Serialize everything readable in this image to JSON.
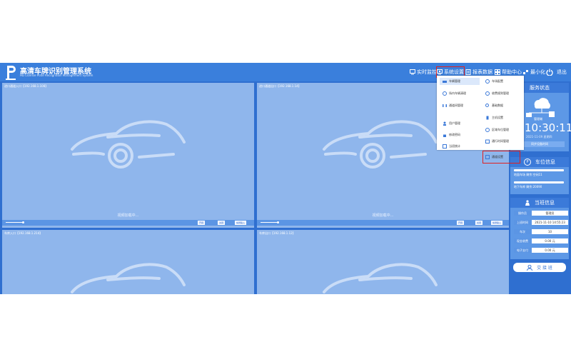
{
  "app": {
    "title": "高清车牌识别管理系统",
    "subtitle": "HD License Plate Recognition Management System"
  },
  "nav": {
    "monitor": "实时监控",
    "settings": "系统设置",
    "reports": "报表数据",
    "help": "帮助中心",
    "minimize": "最小化",
    "exit": "退出"
  },
  "menu": {
    "left": [
      "车辆管理",
      "场内车辆清理",
      "通道间管理",
      "用户管理",
      "修改密码",
      "当班统计"
    ],
    "right": [
      "车场配置",
      "收费规则管理",
      "基础数据",
      "主机设置",
      "区域车位管理",
      "通行时间管理",
      "通道设置"
    ]
  },
  "cameras": [
    {
      "title": "进口通道入口【192.168.1.108】",
      "status": "视频加载中..."
    },
    {
      "title": "进口通道出口【192.168.1.14】",
      "status": "视频加载中..."
    },
    {
      "title": "车库入口【192.168.1.214】",
      "status": ""
    },
    {
      "title": "车库出口【192.168.1.12】",
      "status": ""
    }
  ],
  "camera_controls": {
    "open": "开闸",
    "close": "关闸",
    "manual": "车牌输入"
  },
  "service": {
    "header": "服务状态",
    "server_label": "管理端",
    "clock": "10:30:11",
    "date": "2021-11-09 星期四",
    "sync_button": "同步设备时间"
  },
  "parking": {
    "header": "车位信息",
    "line1": "地面车场 剩余:空闲11",
    "line2": "地下车库 剩余:20090"
  },
  "duty": {
    "header": "当班信息",
    "rows": [
      {
        "label": "操作员",
        "value": "管理员"
      },
      {
        "label": "上班时间",
        "value": "2021-11-10 14:55:23"
      },
      {
        "label": "车次",
        "value": "10"
      },
      {
        "label": "现金收费",
        "value": "0.00 元"
      },
      {
        "label": "电子支付",
        "value": "0.00 元"
      }
    ],
    "shift_button": "交 接 班"
  },
  "colors": {
    "header": "#3a7fdc",
    "background": "#2f6fd0",
    "video": "#8fb6ec",
    "highlight": "#e02020"
  }
}
